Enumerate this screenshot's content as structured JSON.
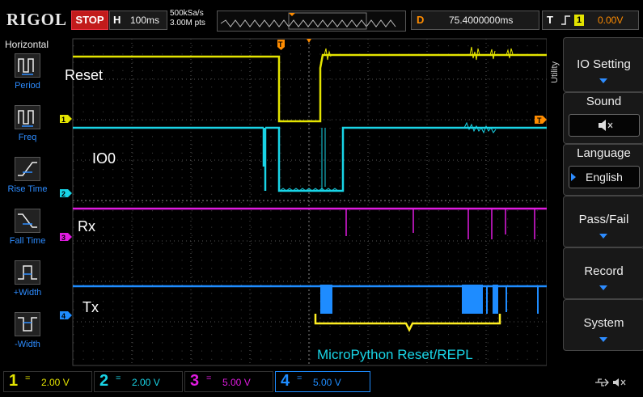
{
  "header": {
    "brand": "RIGOL",
    "run_state": "STOP",
    "timebase_label": "H",
    "timebase_value": "100ms",
    "sample_rate": "500kSa/s",
    "memory_depth": "3.00M pts",
    "delay_label": "D",
    "delay_value": "75.4000000ms",
    "trigger_label": "T",
    "trigger_source": "1",
    "trigger_level": "0.00V"
  },
  "horizontal_menu": {
    "title": "Horizontal",
    "items": [
      {
        "label": "Period",
        "icon": "period-icon"
      },
      {
        "label": "Freq",
        "icon": "freq-icon"
      },
      {
        "label": "Rise Time",
        "icon": "rise-time-icon"
      },
      {
        "label": "Fall Time",
        "icon": "fall-time-icon"
      },
      {
        "label": "+Width",
        "icon": "pos-width-icon"
      },
      {
        "label": "-Width",
        "icon": "neg-width-icon"
      }
    ]
  },
  "utility_menu": {
    "title": "Utility",
    "io_setting": "IO Setting",
    "sound_title": "Sound",
    "language_title": "Language",
    "language_value": "English",
    "pass_fail": "Pass/Fail",
    "record": "Record",
    "system": "System"
  },
  "traces": {
    "ch1_label": "Reset",
    "ch2_label": "IO0",
    "ch3_label": "Rx",
    "ch4_label": "Tx",
    "annotation": "MicroPython Reset/REPL",
    "ch1_marker": "1",
    "ch2_marker": "2",
    "ch3_marker": "3",
    "ch4_marker": "4",
    "trigger_marker": "T"
  },
  "channels": [
    {
      "num": "1",
      "coupling": "=",
      "scale": "2.00 V",
      "color": "#e4e400"
    },
    {
      "num": "2",
      "coupling": "=",
      "scale": "2.00 V",
      "color": "#19d4e6"
    },
    {
      "num": "3",
      "coupling": "=",
      "scale": "5.00 V",
      "color": "#e01be0"
    },
    {
      "num": "4",
      "coupling": "=",
      "scale": "5.00 V",
      "color": "#1e8cff"
    }
  ],
  "colors": {
    "ch1": "#e4e400",
    "ch2": "#19d4e6",
    "ch3": "#e01be0",
    "ch4": "#1e8cff",
    "accent": "#2d8cff",
    "trigger": "#ff8c00",
    "annotation": "#ffee22"
  }
}
